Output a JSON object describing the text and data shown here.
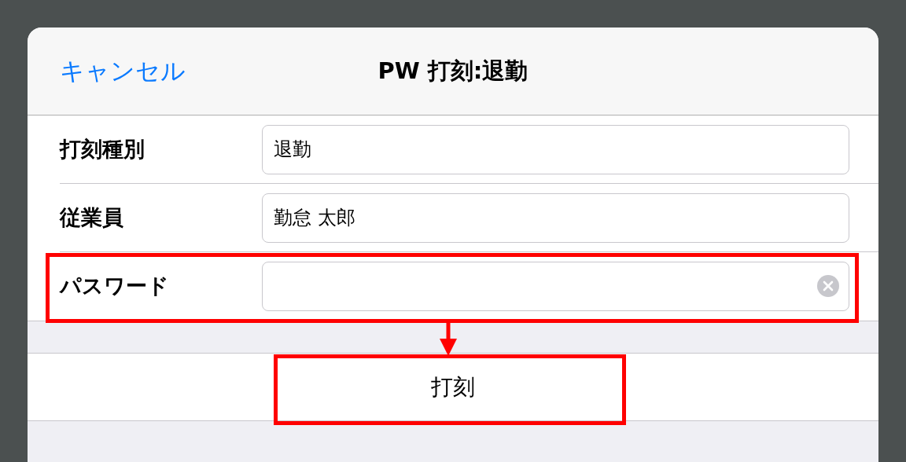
{
  "header": {
    "cancel": "キャンセル",
    "title": "PW 打刻:退勤"
  },
  "fields": [
    {
      "label": "打刻種別",
      "value": "退勤",
      "clear_button": false
    },
    {
      "label": "従業員",
      "value": "勤怠 太郎",
      "clear_button": false
    },
    {
      "label": "パスワード",
      "clear_button": true
    }
  ],
  "submit_button": "打刻"
}
